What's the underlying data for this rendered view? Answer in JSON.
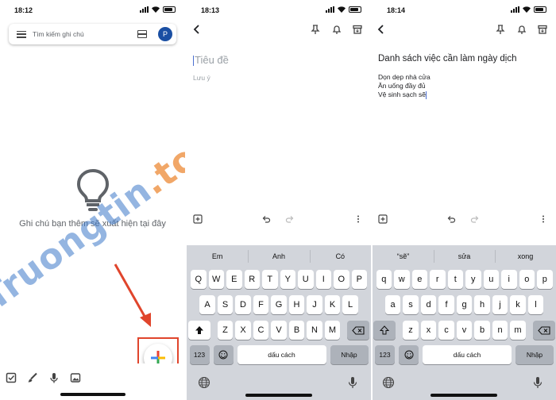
{
  "screen1": {
    "status_time": "18:12",
    "search_placeholder": "Tìm kiếm ghi chú",
    "avatar_letter": "P",
    "empty_text": "Ghi chú bạn thêm sẽ xuất hiện tại đây",
    "watermark_a": "Truongtin",
    "watermark_b": ".top",
    "icons": [
      "menu-icon",
      "grid-view-icon",
      "lightbulb-icon",
      "plus-icon",
      "checkbox-icon",
      "brush-icon",
      "mic-icon",
      "image-icon"
    ]
  },
  "screen2": {
    "status_time": "18:13",
    "title_placeholder": "Tiêu đề",
    "note_placeholder": "Lưu ý",
    "suggestions": [
      "Em",
      "Anh",
      "Có"
    ]
  },
  "screen3": {
    "status_time": "18:14",
    "title": "Danh sách việc cần làm ngày dịch",
    "lines": [
      "Dọn dẹp nhà cửa",
      "Ăn uống đầy đủ",
      "Vệ sinh sạch sẽ"
    ],
    "suggestions": [
      "“sẽ”",
      "sửa",
      "xong"
    ]
  },
  "keyboard": {
    "row1_upper": [
      "Q",
      "W",
      "E",
      "R",
      "T",
      "Y",
      "U",
      "I",
      "O",
      "P"
    ],
    "row2_upper": [
      "A",
      "S",
      "D",
      "F",
      "G",
      "H",
      "J",
      "K",
      "L"
    ],
    "row3_upper": [
      "Z",
      "X",
      "C",
      "V",
      "B",
      "N",
      "M"
    ],
    "row1_lower": [
      "q",
      "w",
      "e",
      "r",
      "t",
      "y",
      "u",
      "i",
      "o",
      "p"
    ],
    "row2_lower": [
      "a",
      "s",
      "d",
      "f",
      "g",
      "h",
      "j",
      "k",
      "l"
    ],
    "row3_lower": [
      "z",
      "x",
      "c",
      "v",
      "b",
      "n",
      "m"
    ],
    "numbers_key": "123",
    "space_key": "dấu cách",
    "return_key": "Nhập"
  },
  "colors": {
    "accent_red": "#e0452c",
    "avatar_blue": "#1a4fa3",
    "keyboard_bg": "#d2d5db"
  }
}
